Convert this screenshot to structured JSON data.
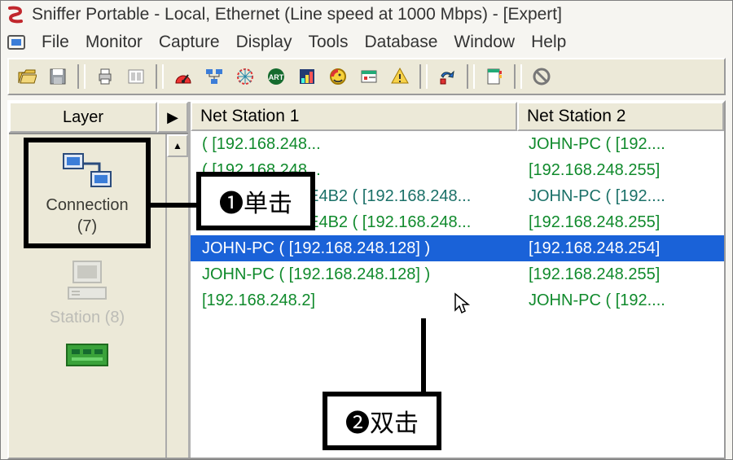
{
  "title": "Sniffer Portable - Local, Ethernet (Line speed at 1000 Mbps) - [Expert]",
  "menu": [
    "File",
    "Monitor",
    "Capture",
    "Display",
    "Tools",
    "Database",
    "Window",
    "Help"
  ],
  "side": {
    "tab": "Layer",
    "items": [
      {
        "label1": "Connection",
        "label2": "(7)"
      },
      {
        "label1": "Station (8)",
        "label2": ""
      }
    ]
  },
  "columns": [
    "Net Station 1",
    "Net Station 2"
  ],
  "rows": [
    {
      "c1": "( [192.168.248...",
      "c2": "JOHN-PC ( [192....",
      "cls": "green"
    },
    {
      "c1": "( [192.168.248...",
      "c2": "[192.168.248.255]",
      "cls": "green"
    },
    {
      "c1": "0E30A653D86E4B2 ( [192.168.248...",
      "c2": "JOHN-PC ( [192....",
      "cls": "teal"
    },
    {
      "c1": "0E30A653D86E4B2 ( [192.168.248...",
      "c2": "[192.168.248.255]",
      "cls": "green"
    },
    {
      "c1": "JOHN-PC ( [192.168.248.128] )",
      "c2": "[192.168.248.254]",
      "cls": "selected"
    },
    {
      "c1": "JOHN-PC ( [192.168.248.128] )",
      "c2": "[192.168.248.255]",
      "cls": "green"
    },
    {
      "c1": "[192.168.248.2]",
      "c2": "JOHN-PC ( [192....",
      "cls": "green"
    }
  ],
  "callouts": {
    "a": "❶单击",
    "b": "❷双击"
  }
}
